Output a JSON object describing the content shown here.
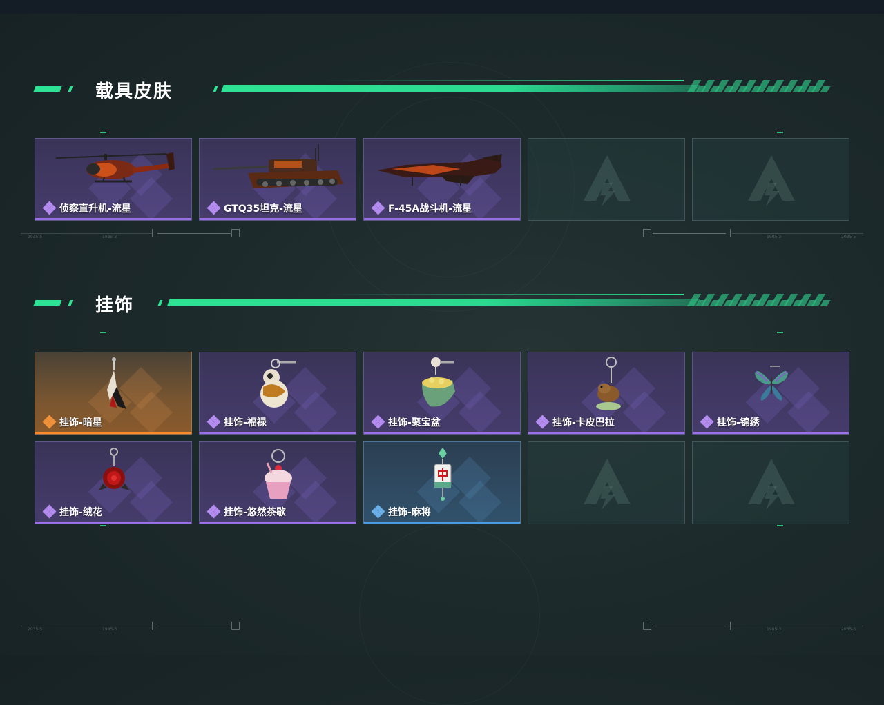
{
  "sections": {
    "vehicle_skins": {
      "title": "载具皮肤",
      "items": [
        {
          "name": "侦察直升机-流星",
          "rarity": "purple",
          "icon": "helicopter-icon"
        },
        {
          "name": "GTQ35坦克-流星",
          "rarity": "purple",
          "icon": "tank-icon"
        },
        {
          "name": "F-45A战斗机-流星",
          "rarity": "purple",
          "icon": "fighter-jet-icon"
        },
        {
          "name": "",
          "rarity": "empty",
          "icon": "empty-slot-logo-icon"
        },
        {
          "name": "",
          "rarity": "empty",
          "icon": "empty-slot-logo-icon"
        }
      ]
    },
    "charms": {
      "title": "挂饰",
      "items": [
        {
          "name": "挂饰-暗星",
          "rarity": "orange",
          "icon": "crane-charm-icon"
        },
        {
          "name": "挂饰-福禄",
          "rarity": "purple",
          "icon": "gourd-charm-icon"
        },
        {
          "name": "挂饰-聚宝盆",
          "rarity": "purple",
          "icon": "treasure-bowl-charm-icon"
        },
        {
          "name": "挂饰-卡皮巴拉",
          "rarity": "purple",
          "icon": "capybara-charm-icon"
        },
        {
          "name": "挂饰-锦绣",
          "rarity": "purple",
          "icon": "butterfly-charm-icon"
        },
        {
          "name": "挂饰-绒花",
          "rarity": "purple",
          "icon": "rose-charm-icon"
        },
        {
          "name": "挂饰-悠然茶歇",
          "rarity": "purple",
          "icon": "cupcake-charm-icon"
        },
        {
          "name": "挂饰-麻将",
          "rarity": "blue",
          "icon": "mahjong-charm-icon"
        },
        {
          "name": "",
          "rarity": "empty",
          "icon": "empty-slot-logo-icon"
        },
        {
          "name": "",
          "rarity": "empty",
          "icon": "empty-slot-logo-icon"
        }
      ]
    }
  },
  "hud": {
    "tiny_labels": [
      "2035-5",
      "1985-3",
      "1985-3",
      "2035-5"
    ]
  },
  "colors": {
    "accent_green": "#2ee293",
    "rarity_purple": "#9a6fe8",
    "rarity_orange": "#ff8a2a",
    "rarity_blue": "#4a9bdf"
  }
}
